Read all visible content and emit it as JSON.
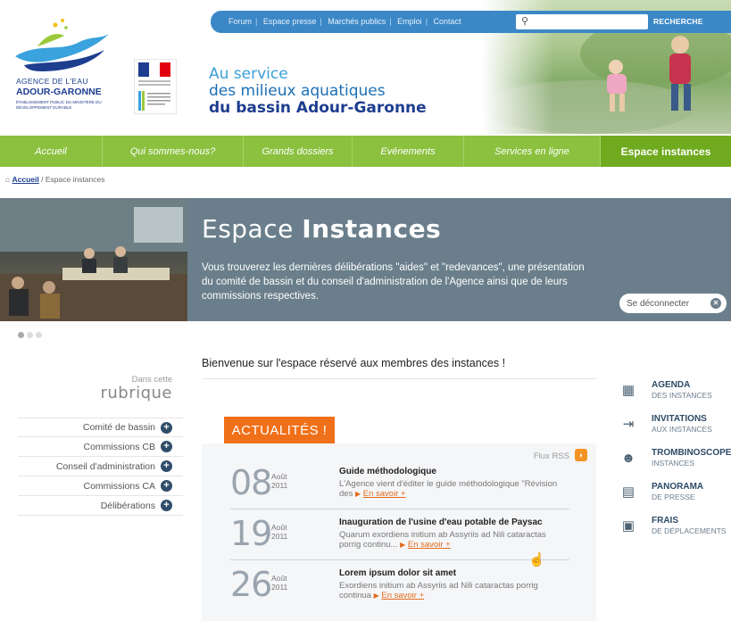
{
  "header": {
    "agence": "AGENCE DE L'EAU",
    "adour": "ADOUR-GARONNE",
    "etablissement": "ÉTABLISSEMENT PUBLIC DU MINISTÈRE DU DÉVELOPPEMENT DURABLE",
    "tagline_1": "Au service",
    "tagline_2": "des milieux aquatiques",
    "tagline_3": "du bassin Adour-Garonne",
    "colors": {
      "blue": "#3c88c7",
      "green": "#8bc13f",
      "orange": "#f0701a"
    }
  },
  "topnav": {
    "links": [
      "Forum",
      "Espace presse",
      "Marchés publics",
      "Emploi",
      "Contact"
    ],
    "search_placeholder": "",
    "search_label": "RECHERCHE"
  },
  "mainnav": {
    "items": [
      "Accueil",
      "Qui sommes-nous?",
      "Grands dossiers",
      "Evénements",
      "Services en ligne",
      "Espace instances"
    ]
  },
  "breadcrumb": {
    "home": "Accueil",
    "sep": " / ",
    "current": "Espace instances"
  },
  "banner": {
    "title_light": "Espace ",
    "title_bold": "Instances",
    "text": "Vous trouverez les dernières délibérations \"aides\" et \"redevances\", une présentation du comité de bassin et du conseil d'administration de l'Agence ainsi que de leurs commissions respectives.",
    "logout": "Se déconnecter"
  },
  "left": {
    "small": "Dans cette",
    "big": "rubrique",
    "menu": [
      "Comité de bassin",
      "Commissions CB",
      "Conseil d'administration",
      "Commissions CA",
      "Délibérations"
    ]
  },
  "main": {
    "welcome": "Bienvenue sur l'espace réservé aux membres des instances !",
    "actualites": "ACTUALITÉS !",
    "rss": "Flux RSS",
    "news": [
      {
        "day": "08",
        "month": "Août",
        "year": "2011",
        "title": "Guide méthodologique",
        "body": "L'Agence vient d'éditer le guide méthodologique \"Révision des",
        "more": "En savoir +"
      },
      {
        "day": "19",
        "month": "Août",
        "year": "2011",
        "title": "Inauguration de l'usine d'eau potable de Paysac",
        "body": "Quarum exordiens initium ab Assyriis ad Nili cataractas porrig continu...",
        "more": "En savoir +"
      },
      {
        "day": "26",
        "month": "Août",
        "year": "2011",
        "title": "Lorem ipsum dolor sit amet",
        "body": "Exordiens initium ab Assyriis ad Nili cataractas porrig continua",
        "more": "En savoir +"
      }
    ]
  },
  "right": {
    "items": [
      {
        "icon": "calendar-icon",
        "t1": "AGENDA",
        "t2": "DES INSTANCES"
      },
      {
        "icon": "login-icon",
        "t1": "INVITATIONS",
        "t2": "AUX INSTANCES"
      },
      {
        "icon": "people-icon",
        "t1": "TROMBINOSCOPE",
        "t2": "INSTANCES"
      },
      {
        "icon": "document-icon",
        "t1": "PANORAMA",
        "t2": "DE PRESSE"
      },
      {
        "icon": "calculator-icon",
        "t1": "FRAIS",
        "t2": "DE DÉPLACEMENTS"
      }
    ]
  }
}
